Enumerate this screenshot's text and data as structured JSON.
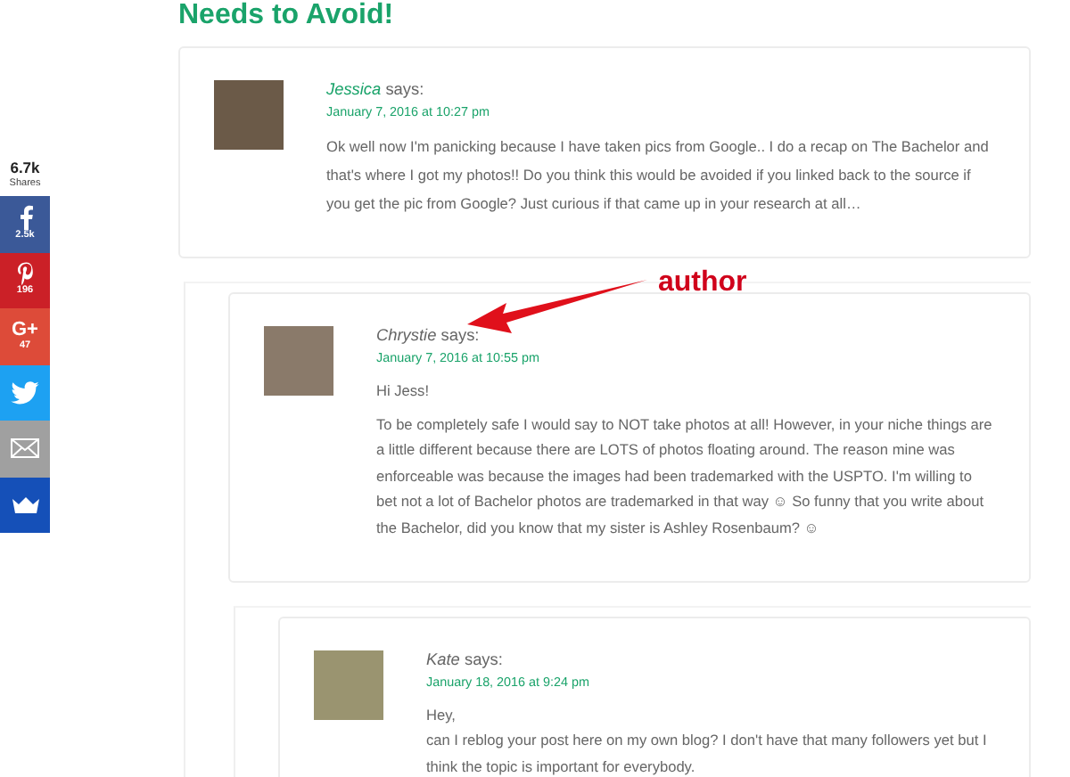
{
  "heading": "Needs to Avoid!",
  "share_bar": {
    "total": "6.7k",
    "total_label": "Shares",
    "buttons": [
      {
        "kind": "facebook",
        "count": "2.5k"
      },
      {
        "kind": "pinterest",
        "count": "196"
      },
      {
        "kind": "googleplus",
        "glyph": "G+",
        "count": "47"
      },
      {
        "kind": "twitter"
      },
      {
        "kind": "email"
      },
      {
        "kind": "crown"
      }
    ]
  },
  "comments": [
    {
      "author": "Jessica",
      "linked": true,
      "says": "says:",
      "date": "January 7, 2016 at 10:27 pm",
      "paragraphs": [
        "Ok well now I'm panicking because I have taken pics from Google.. I do a recap on The Bachelor and that's where I got my photos!! Do you think this would be avoided if you linked back to the source if you get the pic from Google? Just curious if that came up in your research at all…"
      ],
      "children": [
        {
          "author": "Chrystie",
          "linked": false,
          "says": "says:",
          "date": "January 7, 2016 at 10:55 pm",
          "paragraphs": [
            "Hi Jess!",
            "To be completely safe I would say to NOT take photos at all! However, in your niche things are a little different because there are LOTS of photos floating around. The reason mine was enforceable was because the images had been trademarked with the USPTO. I'm willing to bet not a lot of Bachelor photos are trademarked in that way ☺ So funny that you write about the Bachelor, did you know that my sister is Ashley Rosenbaum? ☺"
          ],
          "children": [
            {
              "author": "Kate",
              "linked": false,
              "says": "says:",
              "date": "January 18, 2016 at 9:24 pm",
              "paragraphs": [
                "Hey,\ncan I reblog your post here on my own blog? I don't have that many followers yet but I think the topic is important for everybody."
              ]
            }
          ]
        }
      ]
    }
  ],
  "annotation": {
    "text": "author"
  }
}
